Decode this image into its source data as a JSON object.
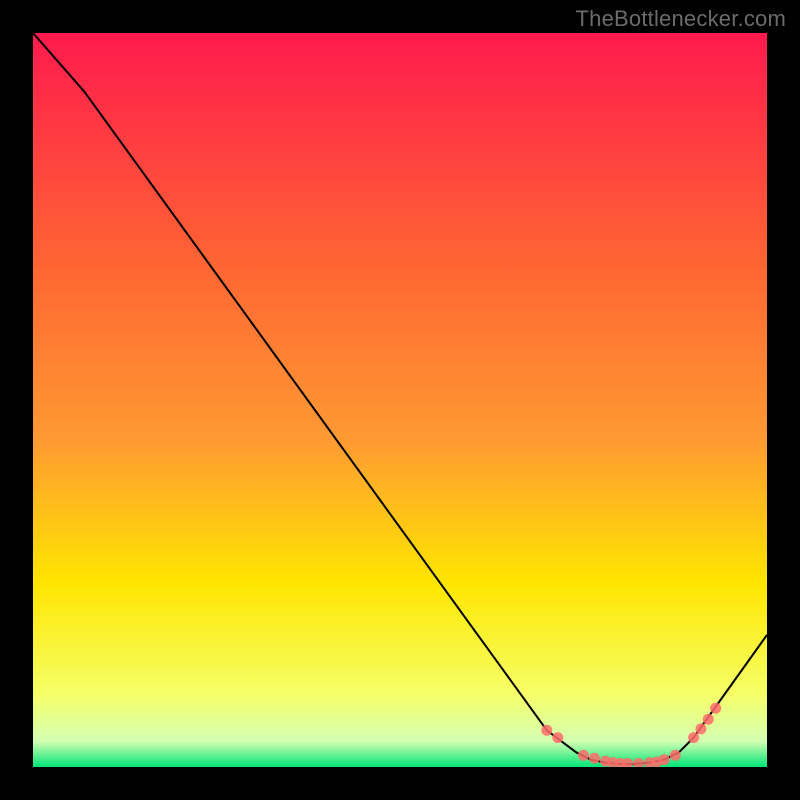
{
  "watermark": "TheBottlenecker.com",
  "chart_data": {
    "type": "line",
    "title": "",
    "xlabel": "",
    "ylabel": "",
    "xlim": [
      0,
      100
    ],
    "ylim": [
      0,
      100
    ],
    "grid": false,
    "gradient_colors": {
      "top": "#ff1a4d",
      "upper_mid": "#ff9933",
      "mid": "#ffe600",
      "lower_mid": "#f6ff66",
      "bottom": "#00e676"
    },
    "series": [
      {
        "name": "bottleneck-curve",
        "color": "#000000",
        "x": [
          0,
          7,
          70,
          74,
          76,
          78,
          80,
          82,
          84,
          86,
          88,
          90,
          100
        ],
        "y": [
          100,
          92,
          5,
          2,
          1,
          0.6,
          0.4,
          0.4,
          0.6,
          1,
          2,
          4,
          18
        ]
      }
    ],
    "markers": {
      "name": "gpu-points",
      "color": "#ff6b6b",
      "x": [
        70,
        71.5,
        75,
        76.5,
        78,
        79,
        80,
        81,
        82.5,
        84,
        85,
        86,
        87.5,
        90,
        91,
        92,
        93
      ],
      "y": [
        5,
        4,
        1.6,
        1.2,
        0.8,
        0.6,
        0.5,
        0.5,
        0.5,
        0.6,
        0.7,
        1,
        1.6,
        4,
        5.2,
        6.5,
        8
      ]
    }
  }
}
